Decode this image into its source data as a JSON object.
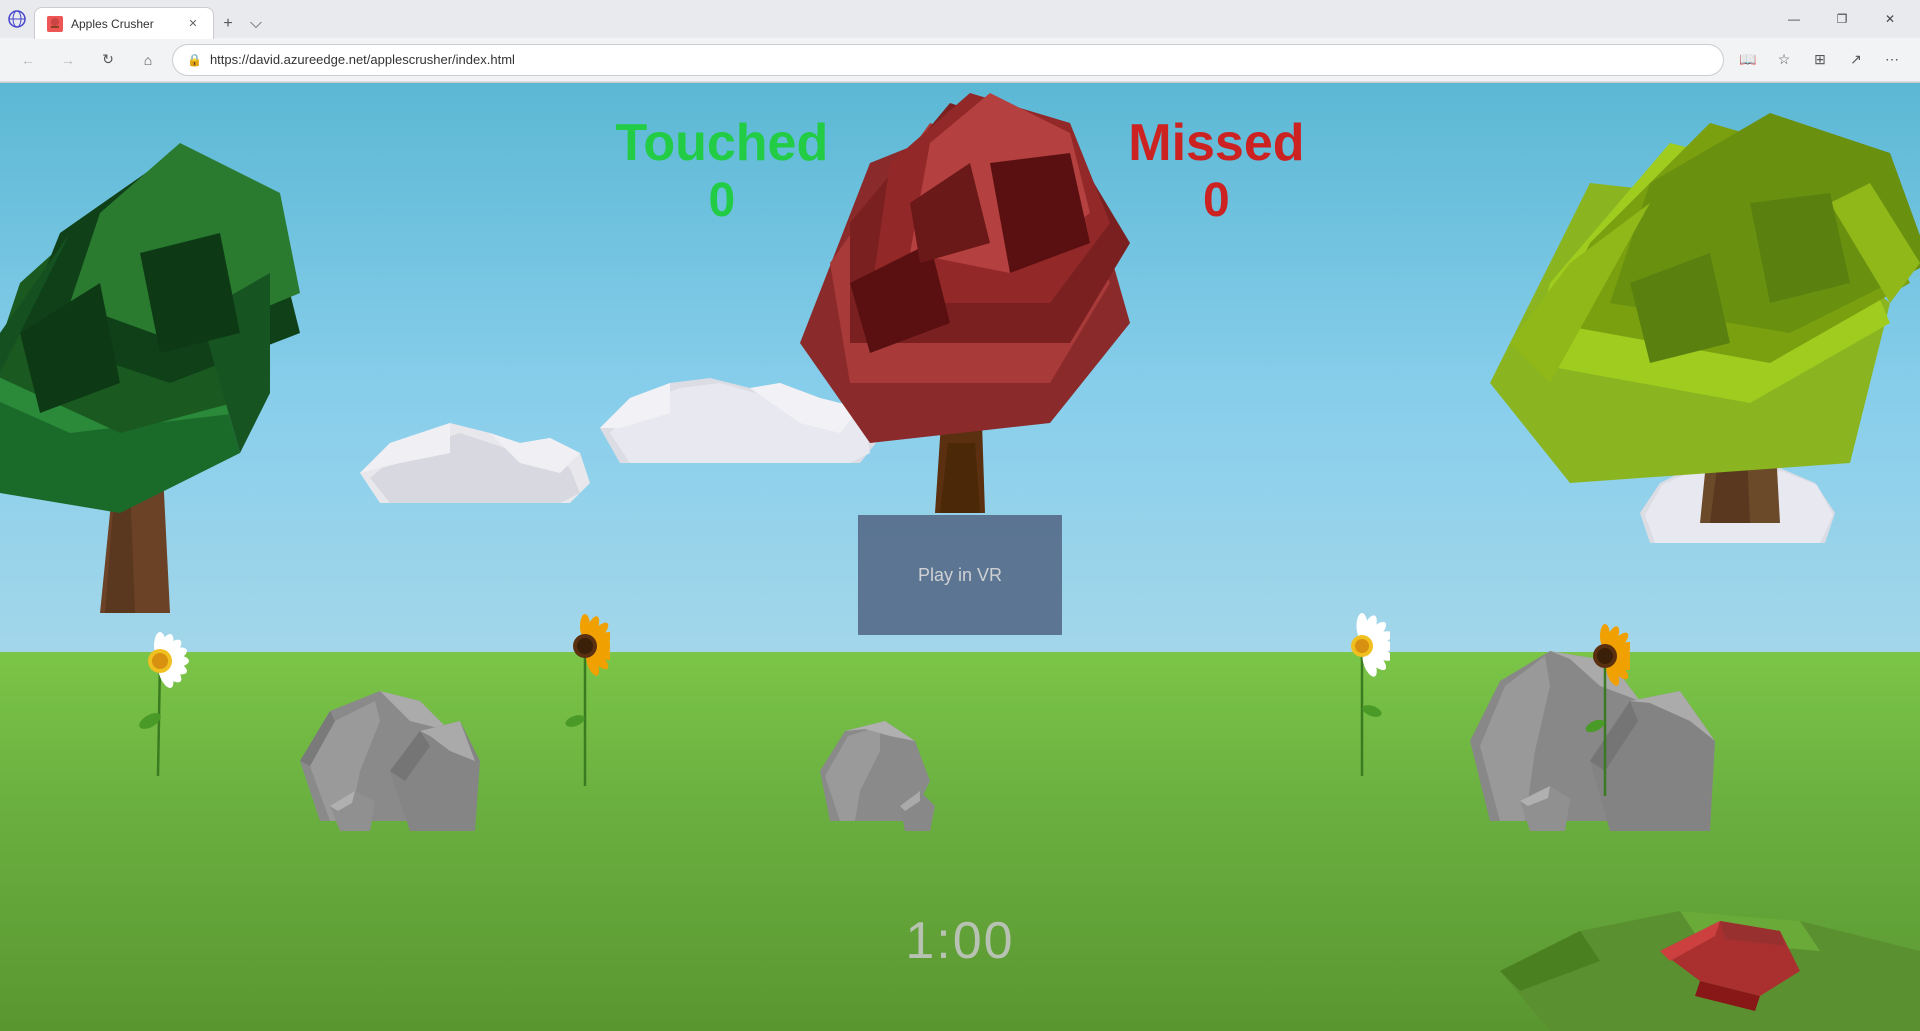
{
  "browser": {
    "title": "Apples Crusher",
    "url": "https://david.azureedge.net/applescrusher/index.html",
    "tab_favicon": "A",
    "new_tab_icon": "+",
    "tab_menu_icon": "⌵"
  },
  "nav": {
    "back_disabled": true,
    "forward_disabled": true
  },
  "game": {
    "touched_label": "Touched",
    "missed_label": "Missed",
    "touched_value": "0",
    "missed_value": "0",
    "timer": "1:00",
    "play_vr_label": "Play in VR"
  },
  "window_controls": {
    "minimize": "—",
    "maximize": "❐",
    "close": "✕"
  }
}
